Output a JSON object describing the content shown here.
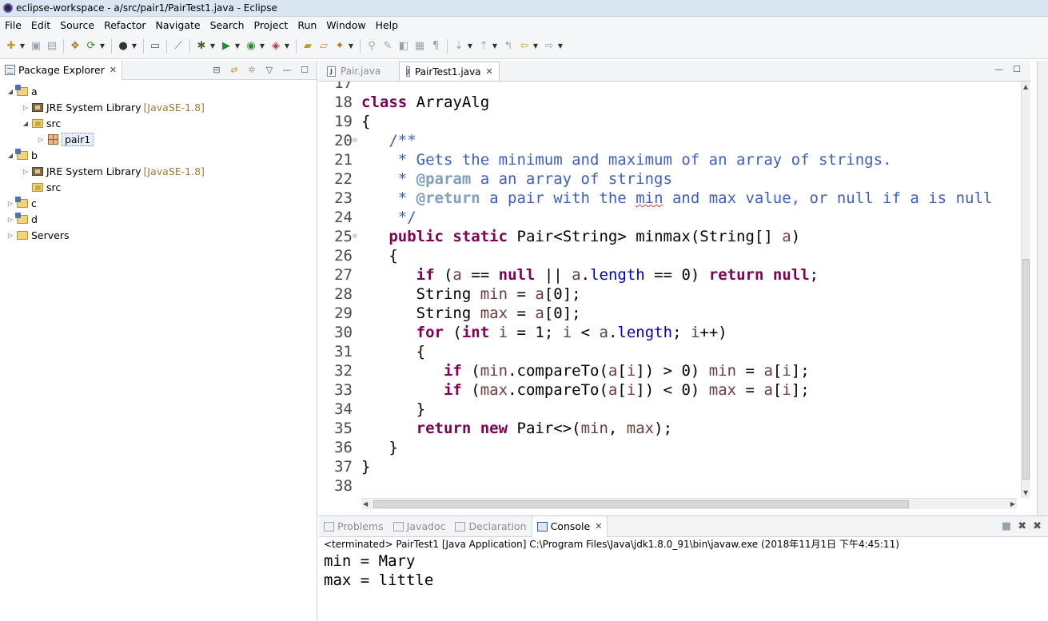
{
  "window": {
    "title": "eclipse-workspace - a/src/pair1/PairTest1.java - Eclipse"
  },
  "menu": [
    "File",
    "Edit",
    "Source",
    "Refactor",
    "Navigate",
    "Search",
    "Project",
    "Run",
    "Window",
    "Help"
  ],
  "package_explorer": {
    "tab_label": "Package Explorer",
    "tree": [
      {
        "label": "a",
        "twisty": "open",
        "indent": 0,
        "icon": "project-icon"
      },
      {
        "label": "JRE System Library",
        "decoration": "[JavaSE-1.8]",
        "twisty": "closed",
        "indent": 1,
        "icon": "library-icon"
      },
      {
        "label": "src",
        "twisty": "open",
        "indent": 1,
        "icon": "source-folder-icon"
      },
      {
        "label": "pair1",
        "twisty": "closed",
        "indent": 2,
        "icon": "package-icon",
        "selected": true
      },
      {
        "label": "b",
        "twisty": "open",
        "indent": 0,
        "icon": "project-icon"
      },
      {
        "label": "JRE System Library",
        "decoration": "[JavaSE-1.8]",
        "twisty": "closed",
        "indent": 1,
        "icon": "library-icon"
      },
      {
        "label": "src",
        "twisty": "none",
        "indent": 1,
        "icon": "source-folder-icon"
      },
      {
        "label": "c",
        "twisty": "closed",
        "indent": 0,
        "icon": "project-icon"
      },
      {
        "label": "d",
        "twisty": "closed",
        "indent": 0,
        "icon": "project-icon"
      },
      {
        "label": "Servers",
        "twisty": "closed",
        "indent": 0,
        "icon": "folder-icon"
      }
    ]
  },
  "editor": {
    "tabs": [
      {
        "label": "Pair.java",
        "active": false
      },
      {
        "label": "PairTest1.java",
        "active": true
      }
    ],
    "lines": [
      {
        "num": "17",
        "fold": false,
        "tokens": []
      },
      {
        "num": "18",
        "fold": false,
        "tokens": [
          {
            "t": "class",
            "c": "kw"
          },
          {
            "t": " ArrayAlg"
          }
        ]
      },
      {
        "num": "19",
        "fold": false,
        "tokens": [
          {
            "t": "{"
          }
        ]
      },
      {
        "num": "20",
        "fold": true,
        "tokens": [
          {
            "t": "   /**",
            "c": "cm"
          }
        ]
      },
      {
        "num": "21",
        "fold": false,
        "tokens": [
          {
            "t": "    * Gets the minimum and maximum of an array of strings.",
            "c": "cm"
          }
        ]
      },
      {
        "num": "22",
        "fold": false,
        "tokens": [
          {
            "t": "    * ",
            "c": "cm"
          },
          {
            "t": "@param",
            "c": "tag"
          },
          {
            "t": " a an array of strings",
            "c": "cm"
          }
        ]
      },
      {
        "num": "23",
        "fold": false,
        "tokens": [
          {
            "t": "    * ",
            "c": "cm"
          },
          {
            "t": "@return",
            "c": "tag"
          },
          {
            "t": " a pair with the ",
            "c": "cm"
          },
          {
            "t": "min",
            "c": "cm spell"
          },
          {
            "t": " and max value, or null if a is null",
            "c": "cm"
          }
        ]
      },
      {
        "num": "24",
        "fold": false,
        "tokens": [
          {
            "t": "    */",
            "c": "cm"
          }
        ]
      },
      {
        "num": "25",
        "fold": true,
        "tokens": [
          {
            "t": "   "
          },
          {
            "t": "public",
            "c": "kw"
          },
          {
            "t": " "
          },
          {
            "t": "static",
            "c": "kw"
          },
          {
            "t": " Pair<String> minmax(String[] "
          },
          {
            "t": "a",
            "c": "var"
          },
          {
            "t": ")"
          }
        ]
      },
      {
        "num": "26",
        "fold": false,
        "tokens": [
          {
            "t": "   {"
          }
        ]
      },
      {
        "num": "27",
        "fold": false,
        "tokens": [
          {
            "t": "      "
          },
          {
            "t": "if",
            "c": "kw"
          },
          {
            "t": " ("
          },
          {
            "t": "a",
            "c": "var"
          },
          {
            "t": " == "
          },
          {
            "t": "null",
            "c": "kw"
          },
          {
            "t": " || "
          },
          {
            "t": "a",
            "c": "var"
          },
          {
            "t": "."
          },
          {
            "t": "length",
            "c": "fld"
          },
          {
            "t": " == 0) "
          },
          {
            "t": "return",
            "c": "kw"
          },
          {
            "t": " "
          },
          {
            "t": "null",
            "c": "kw"
          },
          {
            "t": ";"
          }
        ]
      },
      {
        "num": "28",
        "fold": false,
        "tokens": [
          {
            "t": "      String "
          },
          {
            "t": "min",
            "c": "var"
          },
          {
            "t": " = "
          },
          {
            "t": "a",
            "c": "var"
          },
          {
            "t": "[0];"
          }
        ]
      },
      {
        "num": "29",
        "fold": false,
        "tokens": [
          {
            "t": "      String "
          },
          {
            "t": "max",
            "c": "var"
          },
          {
            "t": " = "
          },
          {
            "t": "a",
            "c": "var"
          },
          {
            "t": "[0];"
          }
        ]
      },
      {
        "num": "30",
        "fold": false,
        "tokens": [
          {
            "t": "      "
          },
          {
            "t": "for",
            "c": "kw"
          },
          {
            "t": " ("
          },
          {
            "t": "int",
            "c": "kw"
          },
          {
            "t": " "
          },
          {
            "t": "i",
            "c": "var"
          },
          {
            "t": " = 1; "
          },
          {
            "t": "i",
            "c": "var"
          },
          {
            "t": " < "
          },
          {
            "t": "a",
            "c": "var"
          },
          {
            "t": "."
          },
          {
            "t": "length",
            "c": "fld"
          },
          {
            "t": "; "
          },
          {
            "t": "i",
            "c": "var"
          },
          {
            "t": "++)"
          }
        ]
      },
      {
        "num": "31",
        "fold": false,
        "tokens": [
          {
            "t": "      {"
          }
        ]
      },
      {
        "num": "32",
        "fold": false,
        "tokens": [
          {
            "t": "         "
          },
          {
            "t": "if",
            "c": "kw"
          },
          {
            "t": " ("
          },
          {
            "t": "min",
            "c": "var"
          },
          {
            "t": ".compareTo("
          },
          {
            "t": "a",
            "c": "var"
          },
          {
            "t": "["
          },
          {
            "t": "i",
            "c": "var"
          },
          {
            "t": "]) > 0) "
          },
          {
            "t": "min",
            "c": "var"
          },
          {
            "t": " = "
          },
          {
            "t": "a",
            "c": "var"
          },
          {
            "t": "["
          },
          {
            "t": "i",
            "c": "var"
          },
          {
            "t": "];"
          }
        ]
      },
      {
        "num": "33",
        "fold": false,
        "tokens": [
          {
            "t": "         "
          },
          {
            "t": "if",
            "c": "kw"
          },
          {
            "t": " ("
          },
          {
            "t": "max",
            "c": "var"
          },
          {
            "t": ".compareTo("
          },
          {
            "t": "a",
            "c": "var"
          },
          {
            "t": "["
          },
          {
            "t": "i",
            "c": "var"
          },
          {
            "t": "]) < 0) "
          },
          {
            "t": "max",
            "c": "var"
          },
          {
            "t": " = "
          },
          {
            "t": "a",
            "c": "var"
          },
          {
            "t": "["
          },
          {
            "t": "i",
            "c": "var"
          },
          {
            "t": "];"
          }
        ]
      },
      {
        "num": "34",
        "fold": false,
        "tokens": [
          {
            "t": "      }"
          }
        ]
      },
      {
        "num": "35",
        "fold": false,
        "tokens": [
          {
            "t": "      "
          },
          {
            "t": "return",
            "c": "kw"
          },
          {
            "t": " "
          },
          {
            "t": "new",
            "c": "kw"
          },
          {
            "t": " Pair<>("
          },
          {
            "t": "min",
            "c": "var"
          },
          {
            "t": ", "
          },
          {
            "t": "max",
            "c": "var"
          },
          {
            "t": ");"
          }
        ]
      },
      {
        "num": "36",
        "fold": false,
        "tokens": [
          {
            "t": "   }"
          }
        ]
      },
      {
        "num": "37",
        "fold": false,
        "tokens": [
          {
            "t": "}"
          }
        ]
      },
      {
        "num": "38",
        "fold": false,
        "tokens": []
      }
    ]
  },
  "bottom_panel": {
    "tabs": [
      {
        "label": "Problems",
        "active": false,
        "name": "tab-problems"
      },
      {
        "label": "Javadoc",
        "active": false,
        "name": "tab-javadoc"
      },
      {
        "label": "Declaration",
        "active": false,
        "name": "tab-declaration"
      },
      {
        "label": "Console",
        "active": true,
        "name": "tab-console"
      }
    ],
    "terminated": "<terminated> PairTest1 [Java Application] C:\\Program Files\\Java\\jdk1.8.0_91\\bin\\javaw.exe (2018年11月1日 下午4:45:11)",
    "output": [
      "min = Mary",
      "max = little"
    ]
  },
  "colors": {
    "keyword": "#7f0055",
    "comment": "#3f5fbf",
    "javadoc_tag": "#7f9fbf",
    "variable": "#6a3e3e",
    "field": "#0000c0"
  }
}
